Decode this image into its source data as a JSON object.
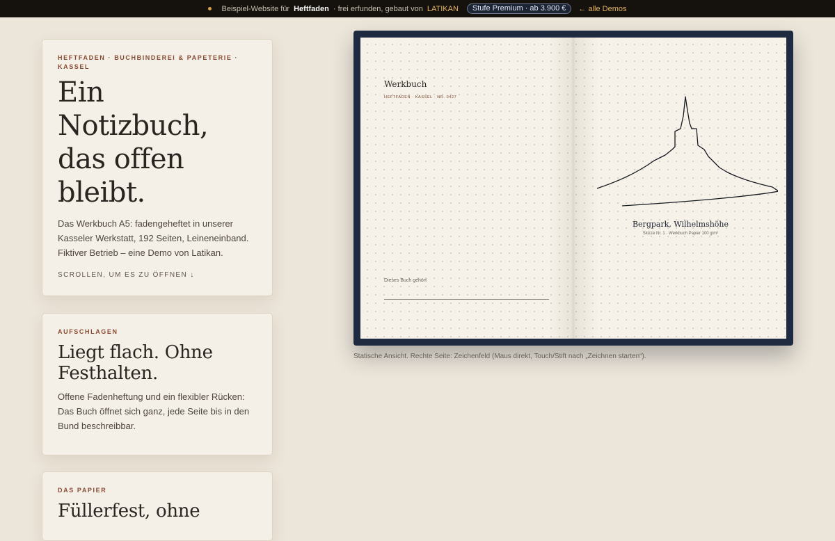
{
  "topbar": {
    "prefix": "Beispiel-Website für",
    "brand": "Heftfaden",
    "middle": "· frei erfunden, gebaut von",
    "maker": "LATIKAN",
    "tier": "Stufe Premium · ab 3.900 €",
    "back": "← alle Demos"
  },
  "hero": {
    "eyebrow": "HEFTFADEN · BUCHBINDEREI & PAPETERIE · KASSEL",
    "title_lines": [
      "Ein",
      "Notizbuch,",
      "das offen",
      "bleibt."
    ],
    "body": "Das Werkbuch A5: fadengeheftet in unserer Kasseler Werkstatt, 192 Seiten, Leineneinband. Fiktiver Betrieb – eine Demo von Latikan.",
    "scroll": "SCROLLEN, UM ES ZU ÖFFNEN ↓"
  },
  "card2": {
    "eyebrow": "AUFSCHLAGEN",
    "title": "Liegt flach. Ohne Festhalten.",
    "body": "Offene Fadenheftung und ein flexibler Rücken: Das Buch öffnet sich ganz, jede Seite bis in den Bund beschreibbar."
  },
  "card3": {
    "eyebrow": "DAS PAPIER",
    "title": "Füllerfest, ohne"
  },
  "notebook": {
    "left_title": "Werkbuch",
    "left_meta": "HEFTFADEN · KASSEL · NR. 0427",
    "owner_label": "Dieses Buch gehört",
    "sketch_title": "Bergpark, Wilhelmshöhe",
    "sketch_sub": "Skizze Nr. 1 · Werkbuch Papier 100 g/m²"
  },
  "caption": "Statische Ansicht. Rechte Seite: Zeichenfeld (Maus direkt, Touch/Stift nach „Zeichnen starten“).",
  "colors": {
    "background": "#ece5d9",
    "accent": "#8a4a32",
    "cover": "#1e2a3f",
    "topbar": "#15110d"
  }
}
